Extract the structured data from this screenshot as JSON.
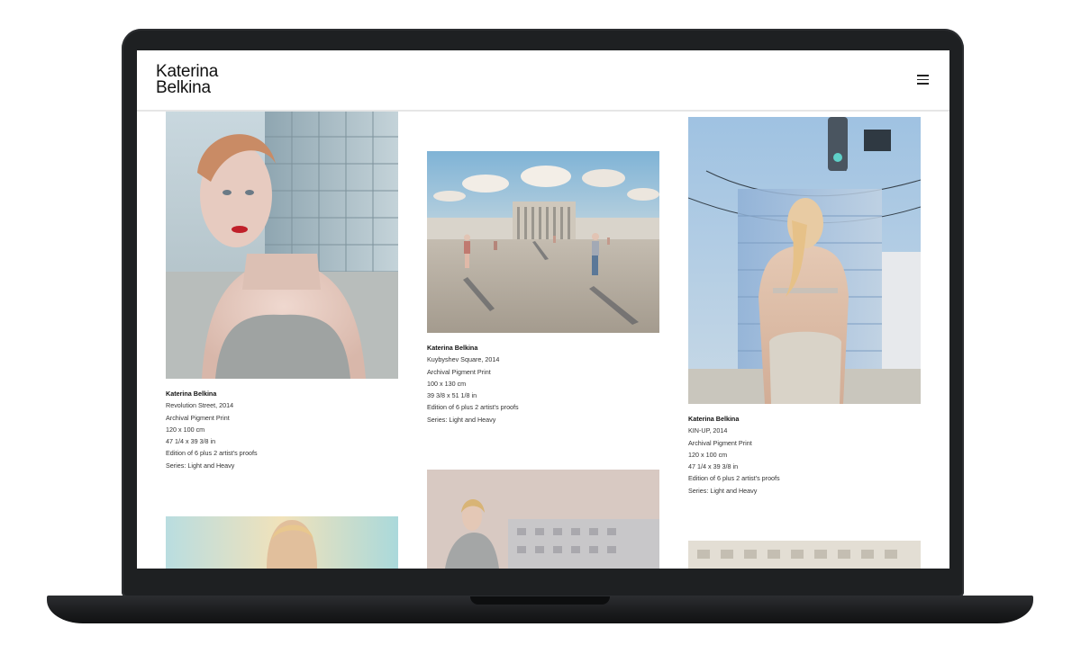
{
  "site": {
    "logo_line1": "Katerina",
    "logo_line2": "Belkina",
    "menu_icon": "hamburger-menu-icon"
  },
  "artworks": [
    {
      "artist": "Katerina Belkina",
      "title": "Revolution Street, 2014",
      "medium": "Archival Pigment Print",
      "size_cm": "120 x 100 cm",
      "size_in": "47 1/4 x 39 3/8 in",
      "edition": "Edition of 6 plus 2 artist's proofs",
      "series": "Series: Light and Heavy"
    },
    {
      "artist": "Katerina Belkina",
      "title": "Kuybyshev Square, 2014",
      "medium": "Archival Pigment Print",
      "size_cm": "100 x 130 cm",
      "size_in": "39 3/8 x 51 1/8 in",
      "edition": "Edition of 6 plus 2 artist's proofs",
      "series": "Series: Light and Heavy"
    },
    {
      "artist": "Katerina Belkina",
      "title": "KIN-UP, 2014",
      "medium": "Archival Pigment Print",
      "size_cm": "120 x 100 cm",
      "size_in": "47 1/4 x 39 3/8 in",
      "edition": "Edition of 6 plus 2 artist's proofs",
      "series": "Series: Light and Heavy"
    }
  ],
  "colors": {
    "device_frame": "#1e2022",
    "page_background": "#ffffff",
    "text": "#333333"
  }
}
